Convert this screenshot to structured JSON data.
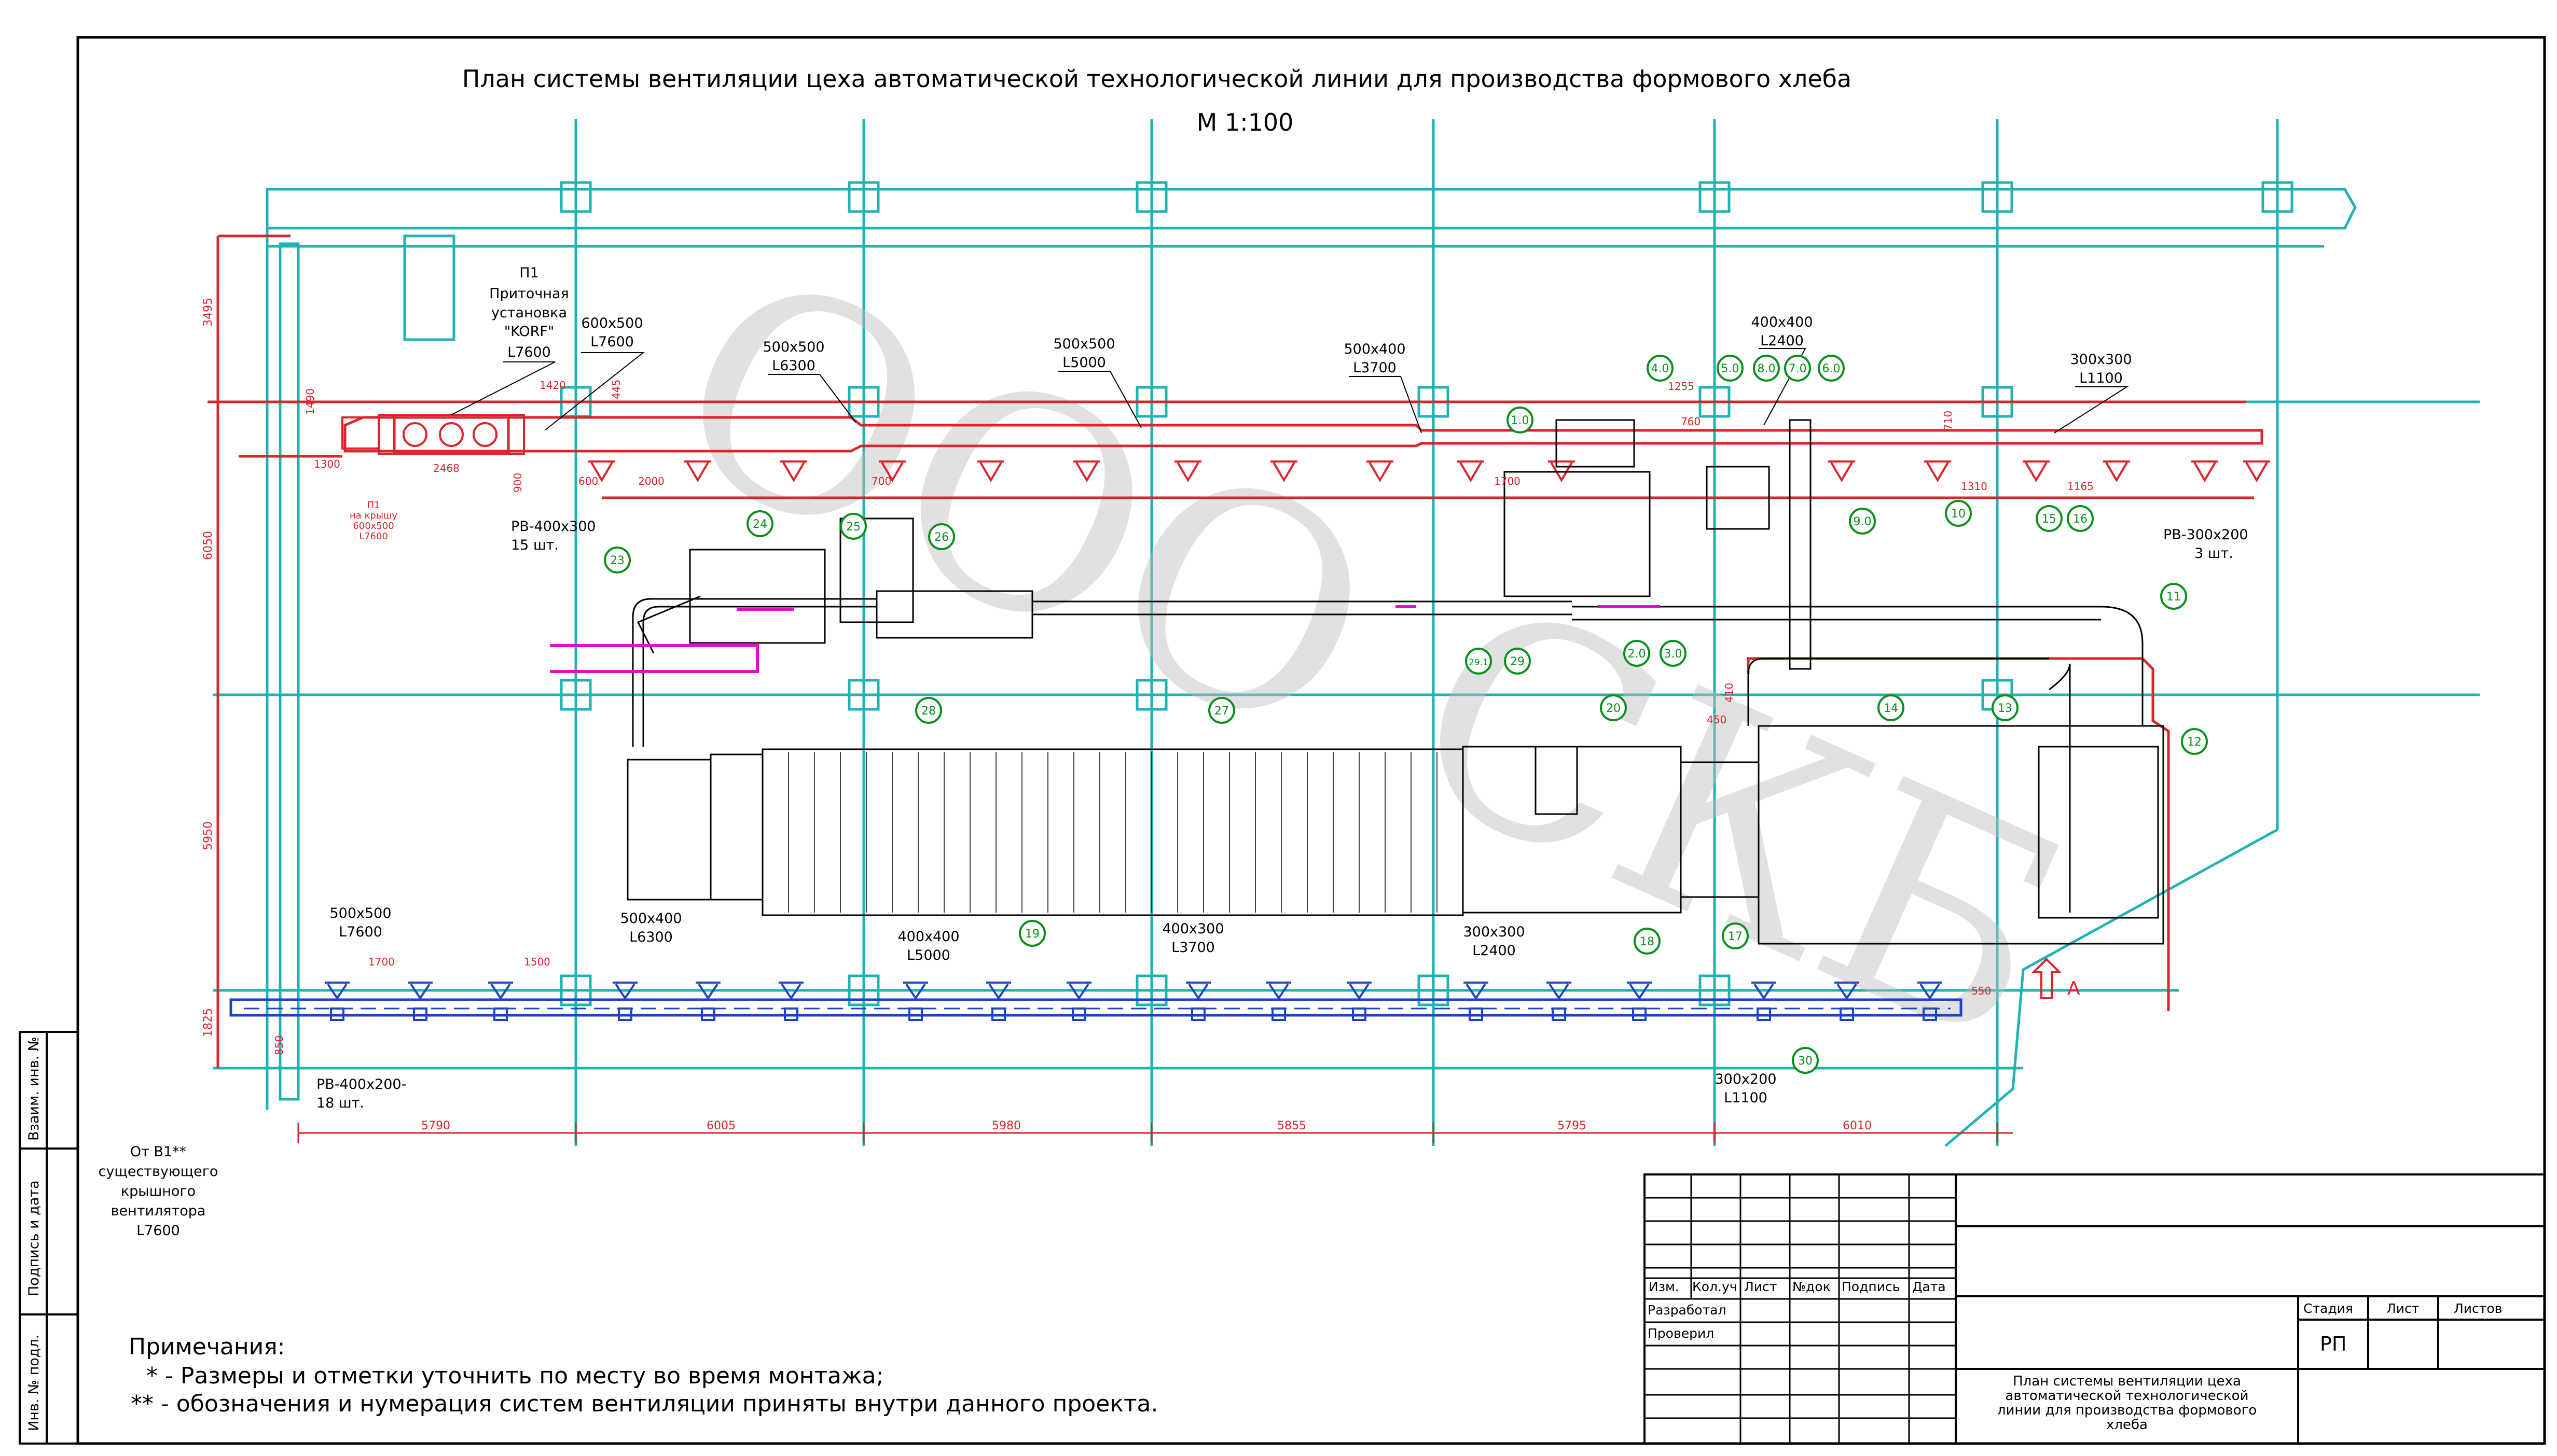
{
  "title": "План системы вентиляции цеха автоматической технологической линии для производства формового хлеба",
  "scale": "М 1:100",
  "watermark": "ООО СКБ",
  "colors": {
    "supply": "#d9252b",
    "exhaust": "#1f43c8",
    "grid": "#1fb3b3",
    "equipment": "#000000",
    "callout": "#0a8f1c",
    "conveyor": "#e010c8"
  },
  "supply_unit": {
    "line1": "П1",
    "line2": "Приточная",
    "line3": "установка",
    "line4": "\"KORF\"",
    "line5": "L7600"
  },
  "roof_note": {
    "line1": "П1",
    "line2": "на крышу",
    "line3": "600x500",
    "line4": "L7600"
  },
  "supply_ducts": [
    {
      "size": "600x500",
      "length": "L7600"
    },
    {
      "size": "500x500",
      "length": "L6300"
    },
    {
      "size": "500x500",
      "length": "L5000"
    },
    {
      "size": "500x400",
      "length": "L3700"
    },
    {
      "size": "400x400",
      "length": "L2400"
    },
    {
      "size": "300x300",
      "length": "L1100"
    }
  ],
  "exhaust_ducts": [
    {
      "size": "500x500",
      "length": "L7600"
    },
    {
      "size": "500x400",
      "length": "L6300"
    },
    {
      "size": "400x400",
      "length": "L5000"
    },
    {
      "size": "400x300",
      "length": "L3700"
    },
    {
      "size": "300x300",
      "length": "L2400"
    },
    {
      "size": "300x200",
      "length": "L1100"
    }
  ],
  "grilles": {
    "rv_400x300": "РВ-400x300",
    "rv_400x300_qty": "15 шт.",
    "rv_300x200": "РВ-300x200",
    "rv_300x200_qty": "3 шт.",
    "rv_400x200": "РВ-400x200-",
    "rv_400x200_qty": "18 шт."
  },
  "exhaust_source": {
    "line1": "От В1**",
    "line2": "существующего",
    "line3": "крышного",
    "line4": "вентилятора",
    "line5": "L7600"
  },
  "bottom_dims": [
    "5790",
    "6005",
    "5980",
    "5855",
    "5795",
    "6010"
  ],
  "left_dims": [
    "3495",
    "6050",
    "5950",
    "1825"
  ],
  "top_dims": {
    "d1420": "1420",
    "d445": "445",
    "d1490": "1490",
    "d1300": "1300",
    "d2468": "2468",
    "d900": "900",
    "d600": "600",
    "d2000": "2000",
    "d700": "700",
    "d1700": "1700",
    "d1310": "1310",
    "d1165": "1165",
    "d1255": "1255",
    "d760": "760",
    "d710": "710",
    "d410": "410",
    "d450": "450"
  },
  "low_dims": {
    "d1700": "1700",
    "d1500": "1500",
    "d550": "550",
    "d850": "850"
  },
  "section_mark": "А",
  "callouts": [
    "1.0",
    "2.0",
    "3.0",
    "4.0",
    "5.0",
    "6.0",
    "7.0",
    "8.0",
    "9.0",
    "10",
    "11",
    "12",
    "13",
    "14",
    "15",
    "16",
    "17",
    "18",
    "19",
    "20",
    "23",
    "24",
    "25",
    "26",
    "27",
    "28",
    "29",
    "29.1",
    "30"
  ],
  "notes": {
    "heading": "Примечания:",
    "n1": "* - Размеры и отметки уточнить по месту во время монтажа;",
    "n2": "** - обозначения и нумерация систем вентиляции приняты внутри данного проекта."
  },
  "title_block": {
    "izm": "Изм.",
    "kol": "Кол.уч",
    "list": "Лист",
    "ndok": "№док",
    "podpis": "Подпись",
    "data": "Дата",
    "razrabotal": "Разработал",
    "proveril": "Проверил",
    "stadiya": "Стадия",
    "list2": "Лист",
    "listov": "Листов",
    "stage_value": "РП",
    "desc1": "План системы вентиляции цеха",
    "desc2": "автоматической технологической",
    "desc3": "линии для производства формового",
    "desc4": "хлеба"
  },
  "side_stamps": {
    "a": "Взаим. инв. №",
    "b": "Подпись и дата",
    "c": "Инв. № подл."
  }
}
